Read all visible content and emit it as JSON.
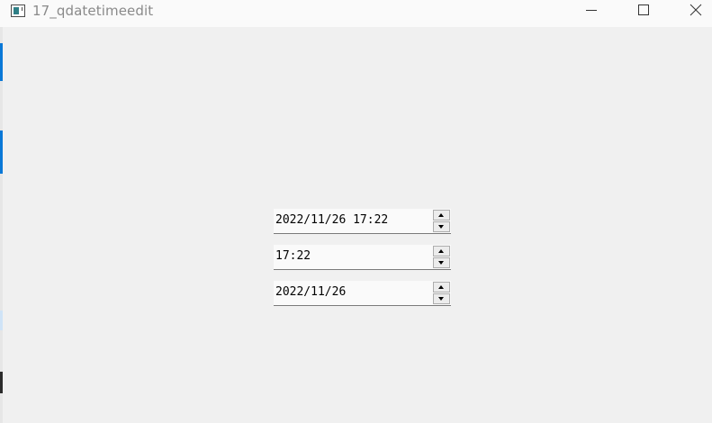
{
  "window": {
    "title": "17_qdatetimeedit",
    "controls": {
      "minimize_icon": "minimize-icon",
      "maximize_icon": "maximize-icon",
      "close_icon": "close-icon"
    }
  },
  "editors": [
    {
      "name": "datetime-edit",
      "value": "2022/11/26 17:22"
    },
    {
      "name": "time-edit",
      "value": "17:22"
    },
    {
      "name": "date-edit",
      "value": "2022/11/26"
    }
  ],
  "colors": {
    "background": "#f0f0f0",
    "titlebar": "#fafafa",
    "edit_background": "#fafafa",
    "accent_left_edge": "#0a78d7"
  }
}
